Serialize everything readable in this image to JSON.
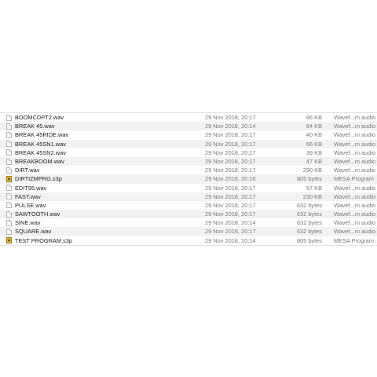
{
  "files": [
    {
      "name": "BOOMCDPT2.wav",
      "date": "29 Nov 2018, 20:17",
      "size": "86 KB",
      "kind": "Wavef...m audio",
      "icon": "audio-file-icon"
    },
    {
      "name": "BREAK 45.wav",
      "date": "29 Nov 2018, 20:14",
      "size": "84 KB",
      "kind": "Wavef...m audio",
      "icon": "audio-file-icon"
    },
    {
      "name": "BREAK 45RIDE.wav",
      "date": "29 Nov 2018, 20:17",
      "size": "40 KB",
      "kind": "Wavef...m audio",
      "icon": "audio-file-icon"
    },
    {
      "name": "BREAK 45SN1.wav",
      "date": "29 Nov 2018, 20:17",
      "size": "66 KB",
      "kind": "Wavef...m audio",
      "icon": "audio-file-icon"
    },
    {
      "name": "BREAK 45SN2.wav",
      "date": "29 Nov 2018, 20:17",
      "size": "39 KB",
      "kind": "Wavef...m audio",
      "icon": "audio-file-icon"
    },
    {
      "name": "BREAKBOOM.wav",
      "date": "29 Nov 2018, 20:17",
      "size": "47 KB",
      "kind": "Wavef...m audio",
      "icon": "audio-file-icon"
    },
    {
      "name": "DIRT.wav",
      "date": "29 Nov 2018, 20:17",
      "size": "290 KB",
      "kind": "Wavef...m audio",
      "icon": "audio-file-icon"
    },
    {
      "name": "DIRTIZMPRG.s3p",
      "date": "29 Nov 2018, 20:16",
      "size": "805 bytes",
      "kind": "MESA Program",
      "icon": "mesa-program-icon"
    },
    {
      "name": "EDIT95.wav",
      "date": "29 Nov 2018, 20:17",
      "size": "97 KB",
      "kind": "Wavef...m audio",
      "icon": "audio-file-icon"
    },
    {
      "name": "FAST.wav",
      "date": "29 Nov 2018, 20:17",
      "size": "230 KB",
      "kind": "Wavef...m audio",
      "icon": "audio-file-icon"
    },
    {
      "name": "PULSE.wav",
      "date": "29 Nov 2018, 20:17",
      "size": "632 bytes",
      "kind": "Wavef...m audio",
      "icon": "audio-file-icon"
    },
    {
      "name": "SAWTOOTH.wav",
      "date": "29 Nov 2018, 20:17",
      "size": "632 bytes",
      "kind": "Wavef...m audio",
      "icon": "audio-file-icon"
    },
    {
      "name": "SINE.wav",
      "date": "29 Nov 2018, 20:14",
      "size": "632 bytes",
      "kind": "Wavef...m audio",
      "icon": "audio-file-icon"
    },
    {
      "name": "SQUARE.wav",
      "date": "29 Nov 2018, 20:17",
      "size": "632 bytes",
      "kind": "Wavef...m audio",
      "icon": "audio-file-icon"
    },
    {
      "name": "TEST PROGRAM.s3p",
      "date": "29 Nov 2018, 20:14",
      "size": "805 bytes",
      "kind": "MESA Program",
      "icon": "mesa-program-icon"
    }
  ],
  "colors": {
    "row_alt": "#f2f2f2",
    "row": "#ffffff",
    "name_text": "#222222",
    "meta_text": "#7a7a7a",
    "program_icon": "#d9b84a"
  }
}
